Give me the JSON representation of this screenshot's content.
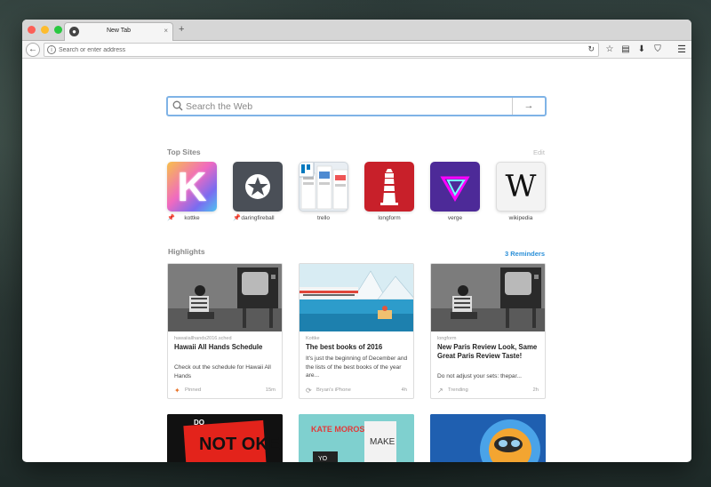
{
  "browser": {
    "tab_title": "New Tab",
    "tab_close": "×",
    "new_tab": "+",
    "url_placeholder": "Search or enter address"
  },
  "search": {
    "placeholder": "Search the Web"
  },
  "top_sites": {
    "title": "Top Sites",
    "edit_label": "Edit",
    "items": [
      {
        "label": "kottke",
        "pinned": true
      },
      {
        "label": "daringfireball",
        "pinned": true
      },
      {
        "label": "trello",
        "pinned": false
      },
      {
        "label": "longform",
        "pinned": false
      },
      {
        "label": "verge",
        "pinned": false
      },
      {
        "label": "wikipedia",
        "pinned": false
      }
    ]
  },
  "highlights": {
    "title": "Highlights",
    "reminders_label": "3 Reminders",
    "cards": [
      {
        "source": "hawaiiallhands2016.sched",
        "title": "Hawaii All Hands Schedule",
        "description": "Check out the schedule for Hawaii All Hands",
        "status": "Pinned",
        "ago": "15m"
      },
      {
        "source": "Kottke",
        "title": "The best books of 2016",
        "description": "It's just the beginning of December and the lists of the best books of the year are...",
        "status": "Bryan's iPhone",
        "ago": "4h"
      },
      {
        "source": "longform",
        "title": "New Paris Review Look, Same Great Paris Review Taste!",
        "description": "Do not adjust your sets: thepar...",
        "status": "Trending",
        "ago": "2h"
      }
    ]
  },
  "tiles": {
    "kottke_letter": "K",
    "wiki_letter": "W"
  },
  "bottom_cards": {
    "card1_text": "NOT OKEY",
    "card1_small": "DO",
    "card2_name": "KATE MOROSS",
    "card2_shirt": "MAKE",
    "card2_sign": "YO"
  },
  "colors": {
    "accent": "#2a8fd8",
    "search_border": "#7fb3e6"
  }
}
